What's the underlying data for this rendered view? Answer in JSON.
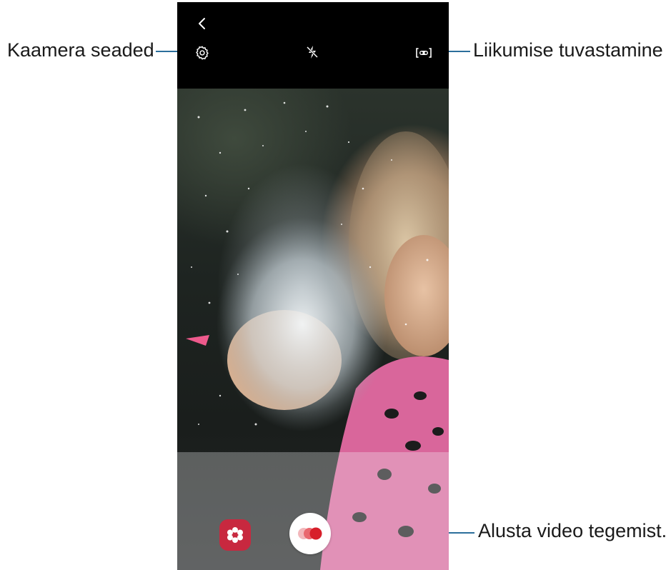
{
  "callouts": {
    "camera_settings": "Kaamera seaded",
    "motion_detection": "Liikumise tuvastamine",
    "start_recording": "Alusta video tegemist."
  },
  "camera": {
    "top_bar": {
      "back_icon": "chevron-left-icon",
      "settings_icon": "gear-icon",
      "flash_icon": "flash-off-icon",
      "motion_icon": "motion-detection-icon"
    },
    "bottom_bar": {
      "effects_icon": "flower-icon",
      "record_icon": "super-slow-record-icon"
    }
  },
  "colors": {
    "leader_line": "#2b6e9b",
    "effects_button": "#c8283f",
    "record_dot": "#d71f2a"
  }
}
